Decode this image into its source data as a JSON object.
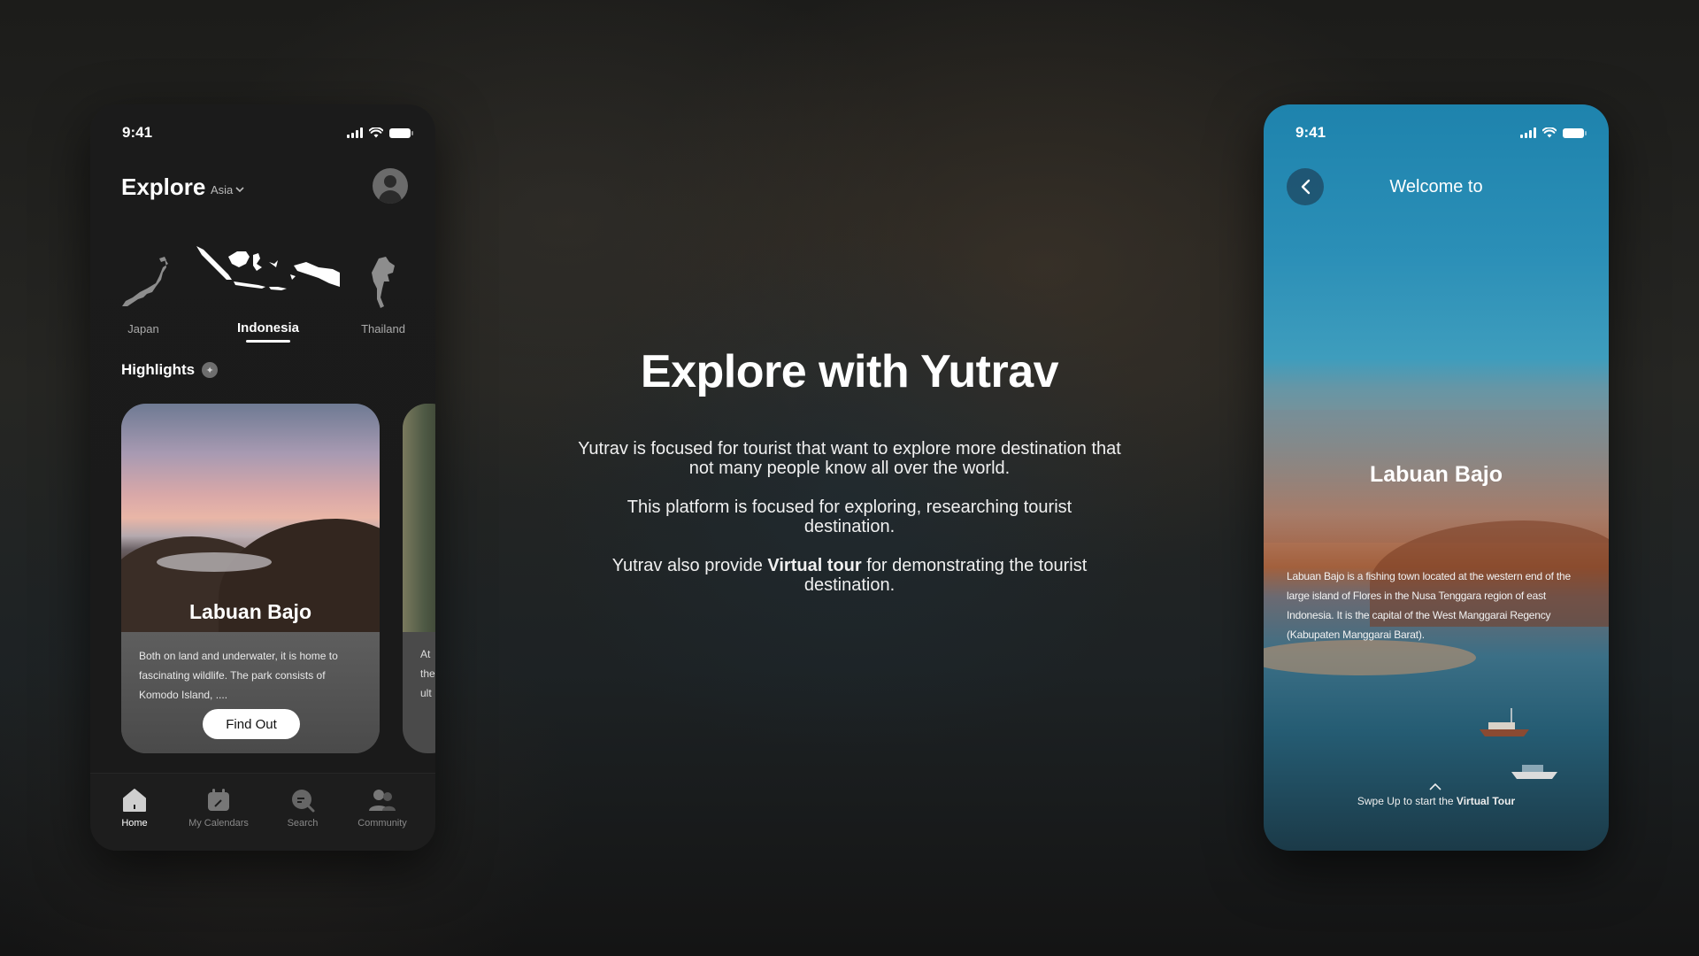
{
  "left_phone": {
    "status_time": "9:41",
    "explore_title": "Explore",
    "region": "Asia",
    "countries": [
      "Japan",
      "Indonesia",
      "Thailand"
    ],
    "active_country": "Indonesia",
    "highlights_label": "Highlights",
    "card": {
      "title": "Labuan Bajo",
      "description": "Both on land and underwater, it is home to fascinating wildlife. The park consists of Komodo Island, ....",
      "button": "Find Out"
    },
    "peek_card_text": [
      "At",
      "the",
      "ult"
    ],
    "tabs": [
      {
        "label": "Home",
        "icon": "home-icon",
        "active": true
      },
      {
        "label": "My Calendars",
        "icon": "calendar-icon",
        "active": false
      },
      {
        "label": "Search",
        "icon": "search-icon",
        "active": false
      },
      {
        "label": "Community",
        "icon": "community-icon",
        "active": false
      }
    ]
  },
  "center": {
    "title": "Explore with Yutrav",
    "paragraph_1": "Yutrav is focused for tourist that want to explore more destination that not many people know all over the world.",
    "paragraph_2": "This platform is focused for exploring, researching tourist destination.",
    "paragraph_3_prefix": "Yutrav also provide ",
    "paragraph_3_bold": "Virtual tour",
    "paragraph_3_suffix": " for demonstrating the tourist destination."
  },
  "right_phone": {
    "status_time": "9:41",
    "welcome": "Welcome to",
    "place_title": "Labuan Bajo",
    "description": "Labuan Bajo is a fishing town located at the western end of the large island of Flores in the Nusa Tenggara region of east Indonesia. It is the capital of the West Manggarai Regency (Kabupaten Manggarai Barat).",
    "swipe_prefix": "Swpe Up to start the ",
    "swipe_bold": "Virtual Tour"
  }
}
